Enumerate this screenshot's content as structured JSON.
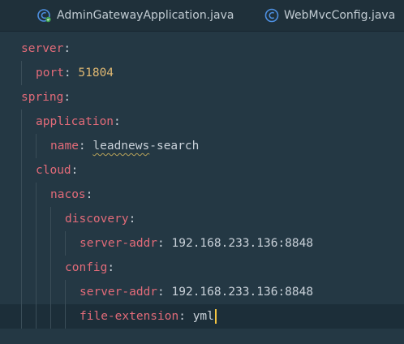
{
  "tabs": [
    {
      "label": "AdminGatewayApplication.java",
      "icon": "spring-boot-class-icon"
    },
    {
      "label": "WebMvcConfig.java",
      "icon": "class-icon"
    }
  ],
  "colors": {
    "background": "#243844",
    "key": "#e26b79",
    "text": "#c9d1d9",
    "number": "#e0b872",
    "caret": "#f5c542"
  },
  "editor": {
    "lines": [
      {
        "key": "server",
        "sep": ":",
        "value": ""
      },
      {
        "key": "port",
        "sep": ": ",
        "value": "51804"
      },
      {
        "key": "spring",
        "sep": ":",
        "value": ""
      },
      {
        "key": "application",
        "sep": ":",
        "value": ""
      },
      {
        "key": "name",
        "sep": ": ",
        "value_typo": "leadnews",
        "value_rest": "-search"
      },
      {
        "key": "cloud",
        "sep": ":",
        "value": ""
      },
      {
        "key": "nacos",
        "sep": ":",
        "value": ""
      },
      {
        "key": "discovery",
        "sep": ":",
        "value": ""
      },
      {
        "key": "server-addr",
        "sep": ": ",
        "value": "192.168.233.136:8848"
      },
      {
        "key": "config",
        "sep": ":",
        "value": ""
      },
      {
        "key": "server-addr",
        "sep": ": ",
        "value": "192.168.233.136:8848"
      },
      {
        "key": "file-extension",
        "sep": ": ",
        "value": "yml"
      }
    ]
  }
}
